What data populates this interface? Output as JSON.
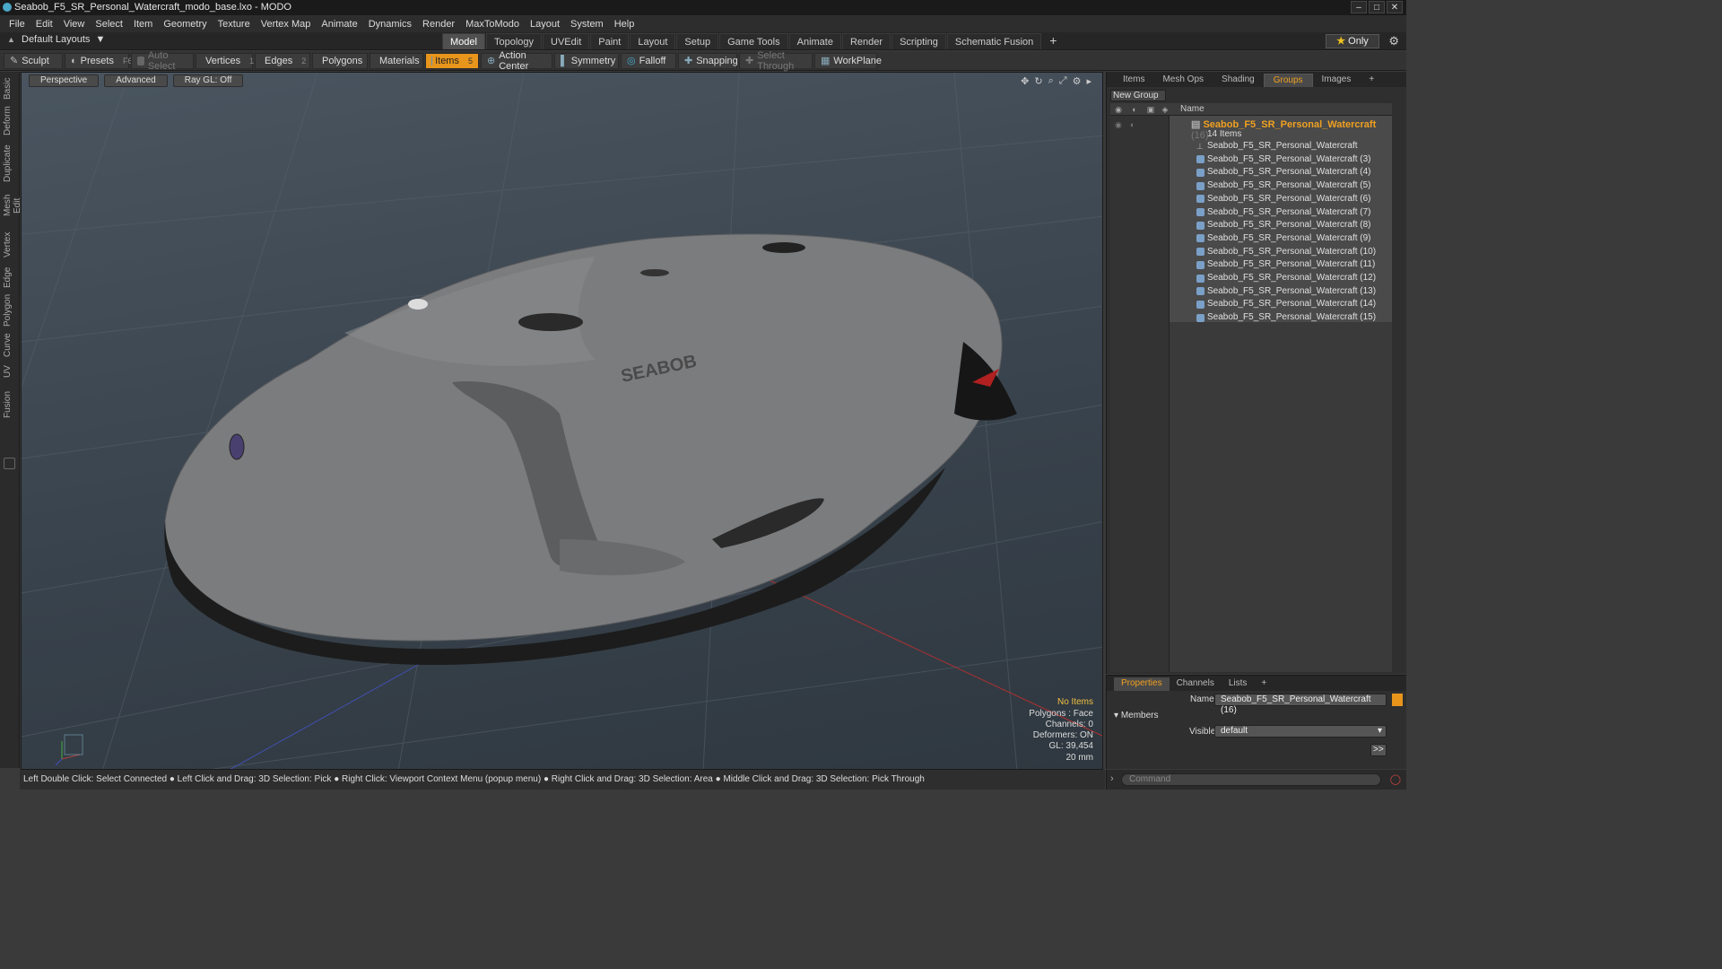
{
  "window": {
    "title": "Seabob_F5_SR_Personal_Watercraft_modo_base.lxo - MODO",
    "buttons": [
      "‒",
      "□",
      "✕"
    ]
  },
  "menu": [
    "File",
    "Edit",
    "View",
    "Select",
    "Item",
    "Geometry",
    "Texture",
    "Vertex Map",
    "Animate",
    "Dynamics",
    "Render",
    "MaxToModo",
    "Layout",
    "System",
    "Help"
  ],
  "layout_selector": "Default Layouts",
  "main_tabs": [
    "Model",
    "Topology",
    "UVEdit",
    "Paint",
    "Layout",
    "Setup",
    "Game Tools",
    "Animate",
    "Render",
    "Scripting",
    "Schematic Fusion"
  ],
  "main_tab_active": "Model",
  "only_button": "Only",
  "tools": {
    "sculpt": "Sculpt",
    "presets": "Presets",
    "presets_key": "F6",
    "auto_select": "Auto Select",
    "vertices": "Vertices",
    "vertices_key": "1",
    "edges": "Edges",
    "edges_key": "2",
    "polygons": "Polygons",
    "materials": "Materials",
    "items": "Items",
    "items_key": "5",
    "action_center": "Action Center",
    "symmetry": "Symmetry",
    "falloff": "Falloff",
    "snapping": "Snapping",
    "select_through": "Select Through",
    "workplane": "WorkPlane"
  },
  "left_tabs": [
    "Basic",
    "Deform",
    "Duplicate",
    "Mesh Edit",
    "Vertex",
    "Edge",
    "Polygon",
    "Curve",
    "UV",
    "Fusion"
  ],
  "viewport": {
    "view_mode": "Perspective",
    "shading": "Advanced",
    "raygl": "Ray GL: Off",
    "logo_text": "SEABOB",
    "info": {
      "items": "No Items",
      "polygons": "Polygons : Face",
      "channels": "Channels: 0",
      "deformers": "Deformers: ON",
      "gl": "GL: 39,454",
      "size": "20 mm"
    }
  },
  "status_text": "Left Double Click: Select Connected ● Left Click and Drag: 3D Selection: Pick ● Right Click: Viewport Context Menu (popup menu) ● Right Click and Drag: 3D Selection: Area ● Middle Click and Drag: 3D Selection: Pick Through",
  "right_panel": {
    "tabs": [
      "Items",
      "Mesh Ops",
      "Shading",
      "Groups",
      "Images"
    ],
    "active_tab": "Groups",
    "new_group": "New Group",
    "column_name": "Name",
    "group_name": "Seabob_F5_SR_Personal_Watercraft",
    "group_count": "(16)",
    "group_subcount": "14 Items",
    "items": [
      "Seabob_F5_SR_Personal_Watercraft",
      "Seabob_F5_SR_Personal_Watercraft (3)",
      "Seabob_F5_SR_Personal_Watercraft (4)",
      "Seabob_F5_SR_Personal_Watercraft (5)",
      "Seabob_F5_SR_Personal_Watercraft (6)",
      "Seabob_F5_SR_Personal_Watercraft (7)",
      "Seabob_F5_SR_Personal_Watercraft (8)",
      "Seabob_F5_SR_Personal_Watercraft (9)",
      "Seabob_F5_SR_Personal_Watercraft (10)",
      "Seabob_F5_SR_Personal_Watercraft (11)",
      "Seabob_F5_SR_Personal_Watercraft (12)",
      "Seabob_F5_SR_Personal_Watercraft (13)",
      "Seabob_F5_SR_Personal_Watercraft (14)",
      "Seabob_F5_SR_Personal_Watercraft (15)"
    ]
  },
  "properties": {
    "tabs": [
      "Properties",
      "Channels",
      "Lists"
    ],
    "active_tab": "Properties",
    "name_label": "Name",
    "name_value": "Seabob_F5_SR_Personal_Watercraft (16)",
    "members_label": "Members",
    "visible_label": "Visible",
    "visible_value": "default",
    "more": ">>"
  },
  "command_placeholder": "Command",
  "colors": {
    "accent": "#e8951c",
    "group_highlight": "#f0a020"
  }
}
